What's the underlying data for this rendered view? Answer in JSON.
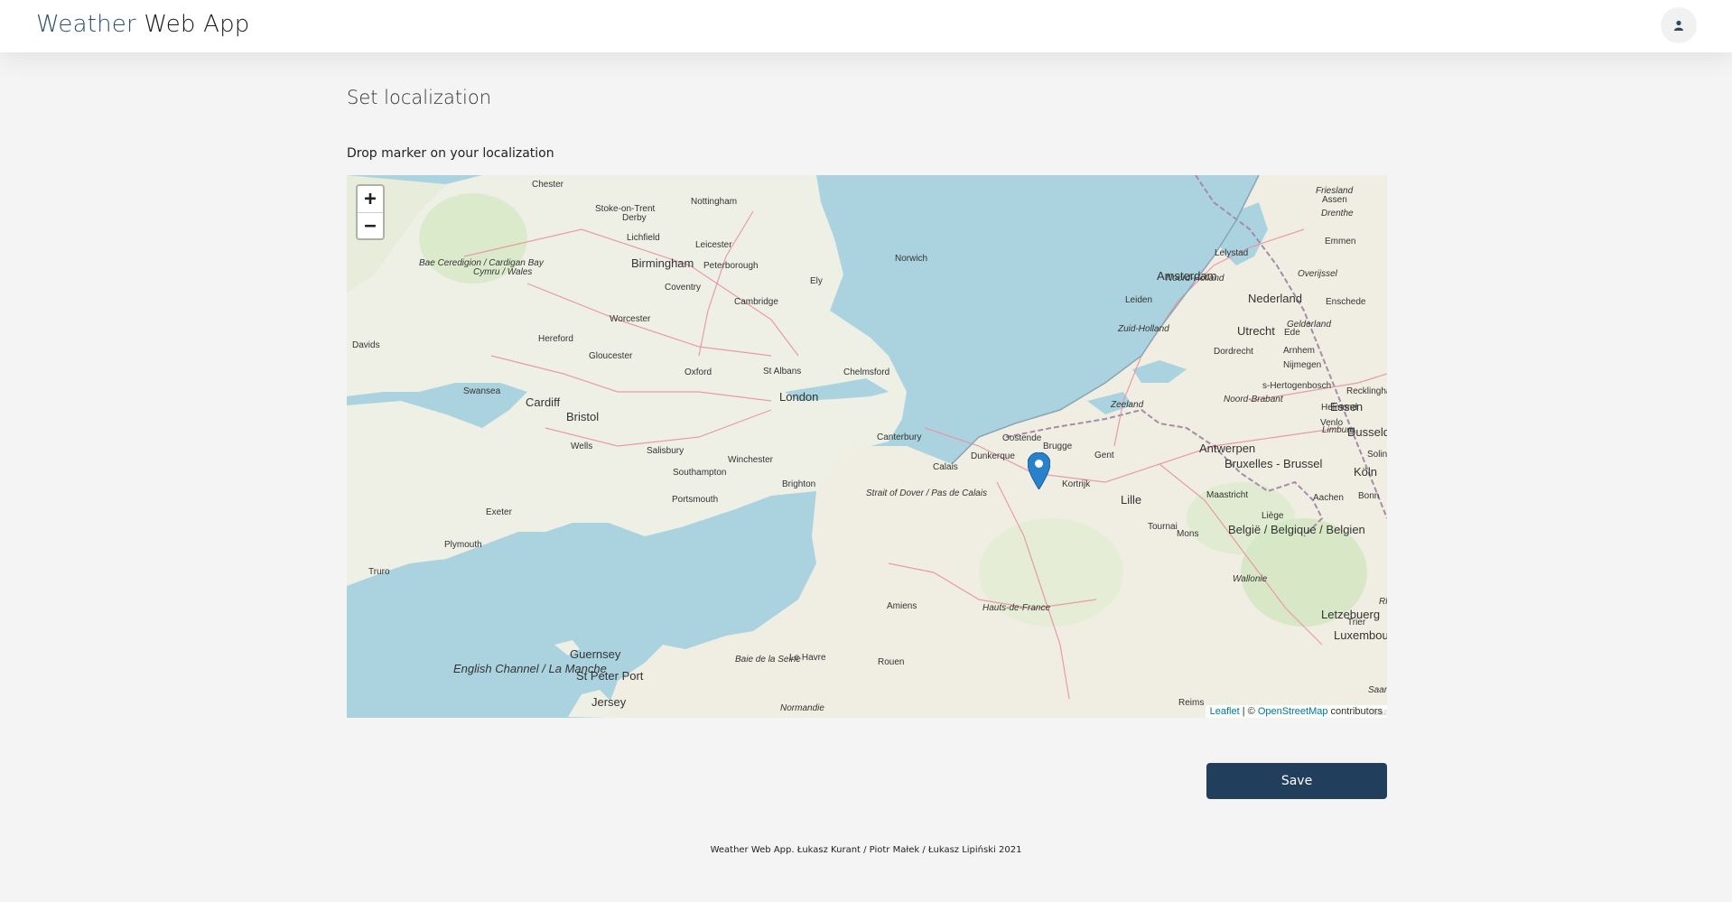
{
  "header": {
    "brand_part1": "Weather",
    "brand_part2": "Web App",
    "user_icon": "user-icon"
  },
  "main": {
    "title": "Set localization",
    "map_label": "Drop marker on your localization",
    "save_label": "Save"
  },
  "map": {
    "zoom_in": "+",
    "zoom_out": "−",
    "attribution_leaflet": "Leaflet",
    "attribution_sep": " | © ",
    "attribution_osm": "OpenStreetMap",
    "attribution_suffix": " contributors",
    "marker_icon": "map-marker-icon",
    "place_labels": [
      "Chester",
      "Stoke-on-Trent",
      "Nottingham",
      "Derby",
      "Lichfield",
      "Leicester",
      "Birmingham",
      "Peterborough",
      "Ely",
      "Norwich",
      "Coventry",
      "Cambridge",
      "Worcester",
      "Hereford",
      "Gloucester",
      "Oxford",
      "St Albans",
      "Chelmsford",
      "London",
      "Swansea",
      "Cardiff",
      "Bristol",
      "Wells",
      "Salisbury",
      "Winchester",
      "Canterbury",
      "Southampton",
      "Brighton",
      "Portsmouth",
      "Exeter",
      "Plymouth",
      "Truro",
      "Davids",
      "Cymru / Wales",
      "Bae Ceredigion / Cardigan Bay",
      "Strait of Dover / Pas de Calais",
      "English Channel / La Manche",
      "Guernsey",
      "St Peter Port",
      "Jersey",
      "Baie de la Seine",
      "Normandie",
      "Le Havre",
      "Rouen",
      "Amiens",
      "Hauts-de-France",
      "Calais",
      "Dunkerque",
      "Oostende",
      "Brugge",
      "Gent",
      "Kortrijk",
      "Lille",
      "Tournai",
      "Mons",
      "Antwerpen",
      "Bruxelles - Brussel",
      "België / Belgique / Belgien",
      "Wallonie",
      "Maastricht",
      "Liège",
      "Aachen",
      "Köln",
      "Bonn",
      "Solingen",
      "Dusseldorf",
      "Essen",
      "Recklinghausen",
      "Venlo",
      "Helmond",
      "Limburg",
      "s-Hertogenbosch",
      "Nijmegen",
      "Arnhem",
      "Gelderland",
      "Ede",
      "Utrecht",
      "Dordrecht",
      "Zuid-Holland",
      "Zeeland",
      "Noord-Brabant",
      "Leiden",
      "Amsterdam",
      "Noord-Holland",
      "Lelystad",
      "Nederland",
      "Overijssel",
      "Enschede",
      "Emmen",
      "Drenthe",
      "Assen",
      "Friesland",
      "Letzebuerg",
      "Luxembourg",
      "Trier",
      "Saarbrücken",
      "Saarland",
      "Rhein Pfc",
      "Reims"
    ]
  },
  "footer": {
    "text": "Weather Web App. Łukasz Kurant / Piotr Małek / Łukasz Lipiński 2021"
  }
}
